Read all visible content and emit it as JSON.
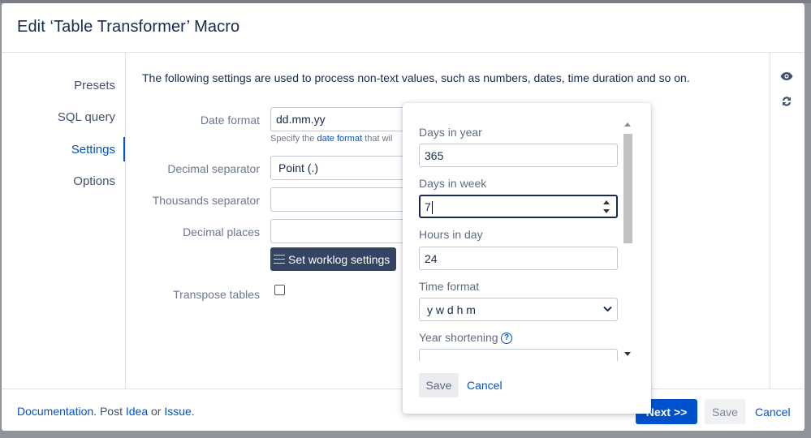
{
  "dialog": {
    "title": "Edit ‘Table Transformer’ Macro"
  },
  "nav": {
    "items": [
      {
        "label": "Presets"
      },
      {
        "label": "SQL query"
      },
      {
        "label": "Settings"
      },
      {
        "label": "Options"
      }
    ],
    "active": "Settings"
  },
  "settings": {
    "intro": "The following settings are used to process non-text values, such as numbers, dates, time duration and so on.",
    "date_format_label": "Date format",
    "date_format_value": "dd.mm.yy",
    "hint_prefix": "Specify the ",
    "hint_link": "date format",
    "hint_suffix": " that wil",
    "decimal_separator_label": "Decimal separator",
    "decimal_separator_value": "Point (.)",
    "thousands_separator_label": "Thousands separator",
    "thousands_separator_value": "",
    "decimal_places_label": "Decimal places",
    "decimal_places_value": "",
    "worklog_button": "Set worklog settings",
    "transpose_label": "Transpose tables",
    "transpose_checked": false
  },
  "worklog_popup": {
    "days_in_year_label": "Days in year",
    "days_in_year_value": "365",
    "days_in_week_label": "Days in week",
    "days_in_week_value": "7",
    "hours_in_day_label": "Hours in day",
    "hours_in_day_value": "24",
    "time_format_label": "Time format",
    "time_format_value": "y w d h m",
    "year_shortening_label": "Year shortening",
    "year_shortening_value": "",
    "save_label": "Save",
    "cancel_label": "Cancel"
  },
  "footer": {
    "documentation": "Documentation",
    "post_text": ". Post ",
    "idea": "Idea",
    "or_text": " or ",
    "issue": "Issue",
    "period": ".",
    "next_label": "Next >>",
    "save_label": "Save",
    "cancel_label": "Cancel"
  },
  "icons": {
    "preview": "eye-icon",
    "refresh": "refresh-icon",
    "help": "help-icon",
    "menu": "hamburger-icon"
  },
  "colors": {
    "accent": "#0052cc",
    "dark_button": "#344563",
    "backdrop": "#8f939a"
  }
}
